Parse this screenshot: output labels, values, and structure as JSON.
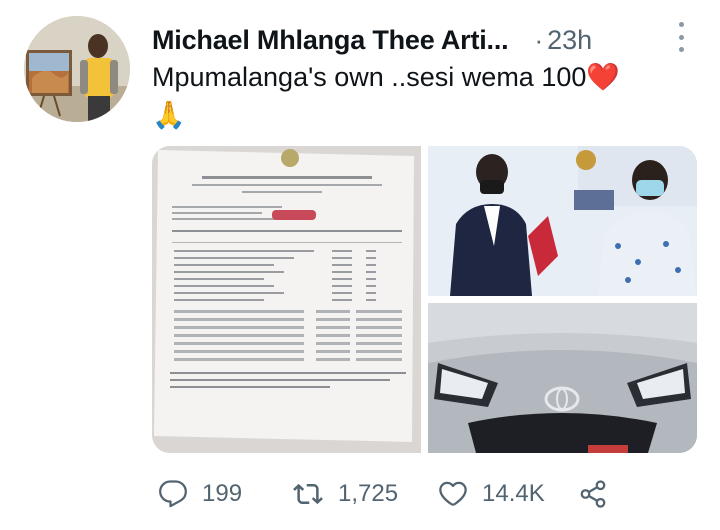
{
  "tweet": {
    "author_name": "Michael Mhlanga Thee Arti...",
    "separator": "·",
    "time": "23h",
    "text": "Mpumalanga's own ..sesi wema 100",
    "heart_emoji": "❤️",
    "pray_emoji": "🙏"
  },
  "actions": {
    "replies": "199",
    "retweets": "1,725",
    "likes": "14.4K"
  },
  "colors": {
    "text": "#0f1419",
    "secondary": "#536471",
    "heart": "#e0245e"
  },
  "icons": [
    "more-icon",
    "reply-icon",
    "retweet-icon",
    "like-icon",
    "share-icon"
  ]
}
